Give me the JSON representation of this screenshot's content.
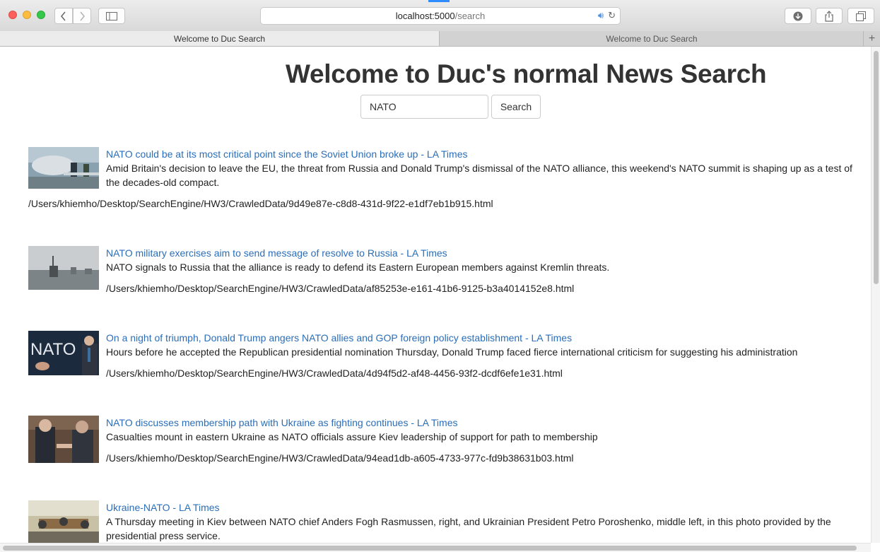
{
  "browser": {
    "url_host": "localhost:5000",
    "url_path": "/search",
    "tabs": [
      {
        "label": "Welcome to Duc Search",
        "active": true
      },
      {
        "label": "Welcome to Duc Search",
        "active": false
      }
    ]
  },
  "page": {
    "title": "Welcome to Duc's normal News Search",
    "search_value": "NATO",
    "search_button": "Search"
  },
  "results": [
    {
      "title": "NATO could be at its most critical point since the Soviet Union broke up - LA Times",
      "description": "Amid Britain's decision to leave the EU, the threat from Russia and Donald Trump's dismissal of the NATO alliance, this weekend's NATO summit is shaping up as a test of the decades-old compact.",
      "path": "/Users/khiemho/Desktop/SearchEngine/HW3/CrawledData/9d49e87e-c8d8-431d-9f22-e1df7eb1b915.html"
    },
    {
      "title": "NATO military exercises aim to send message of resolve to Russia - LA Times",
      "description": "NATO signals to Russia that the alliance is ready to defend its Eastern European members against Kremlin threats.",
      "path": "/Users/khiemho/Desktop/SearchEngine/HW3/CrawledData/af85253e-e161-41b6-9125-b3a4014152e8.html"
    },
    {
      "title": "On a night of triumph, Donald Trump angers NATO allies and GOP foreign policy establishment - LA Times",
      "description": "Hours before he accepted the Republican presidential nomination Thursday, Donald Trump faced fierce international criticism for suggesting his administration",
      "path": "/Users/khiemho/Desktop/SearchEngine/HW3/CrawledData/4d94f5d2-af48-4456-93f2-dcdf6efe1e31.html",
      "thumb_text": "NATO"
    },
    {
      "title": "NATO discusses membership path with Ukraine as fighting continues - LA Times",
      "description": "Casualties mount in eastern Ukraine as NATO officials assure Kiev leadership of support for path to membership",
      "path": "/Users/khiemho/Desktop/SearchEngine/HW3/CrawledData/94ead1db-a605-4733-977c-fd9b38631b03.html"
    },
    {
      "title": "Ukraine-NATO - LA Times",
      "description": "A Thursday meeting in Kiev between NATO chief Anders Fogh Rasmussen, right, and Ukrainian President Petro Poroshenko, middle left, in this photo provided by the presidential press service.",
      "path": ""
    }
  ]
}
